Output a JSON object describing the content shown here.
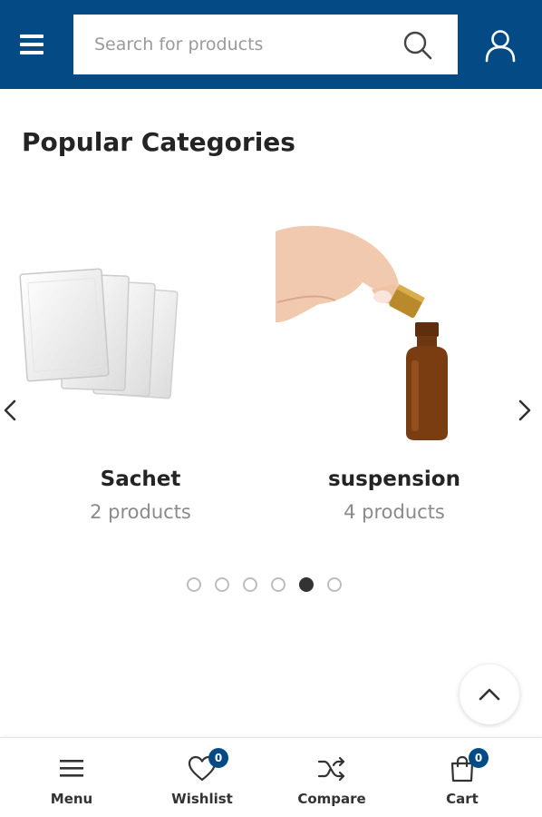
{
  "header": {
    "background": "#044a85",
    "menu_icon": "hamburger-icon",
    "search": {
      "placeholder": "Search for products",
      "value": "",
      "icon": "search-icon"
    },
    "account_icon": "user-icon"
  },
  "section": {
    "title": "Popular Categories"
  },
  "carousel": {
    "prev_icon": "chevron-left-icon",
    "next_icon": "chevron-right-icon",
    "categories": [
      {
        "name": "Sachet",
        "count": "2 products",
        "image": "sachet-image"
      },
      {
        "name": "suspension",
        "count": "4 products",
        "image": "dropper-bottle-image"
      }
    ],
    "dots_total": 6,
    "active_dot": 5
  },
  "scroll_top_icon": "chevron-up-icon",
  "toolbar": {
    "items": [
      {
        "label": "Menu",
        "icon": "hamburger-icon"
      },
      {
        "label": "Wishlist",
        "icon": "heart-icon",
        "badge": "0"
      },
      {
        "label": "Compare",
        "icon": "shuffle-icon"
      },
      {
        "label": "Cart",
        "icon": "shopping-bag-icon",
        "badge": "0"
      }
    ]
  },
  "colors": {
    "accent": "#044a85",
    "title": "#242424",
    "muted": "#8a8a8a",
    "dot_active": "#333333"
  }
}
